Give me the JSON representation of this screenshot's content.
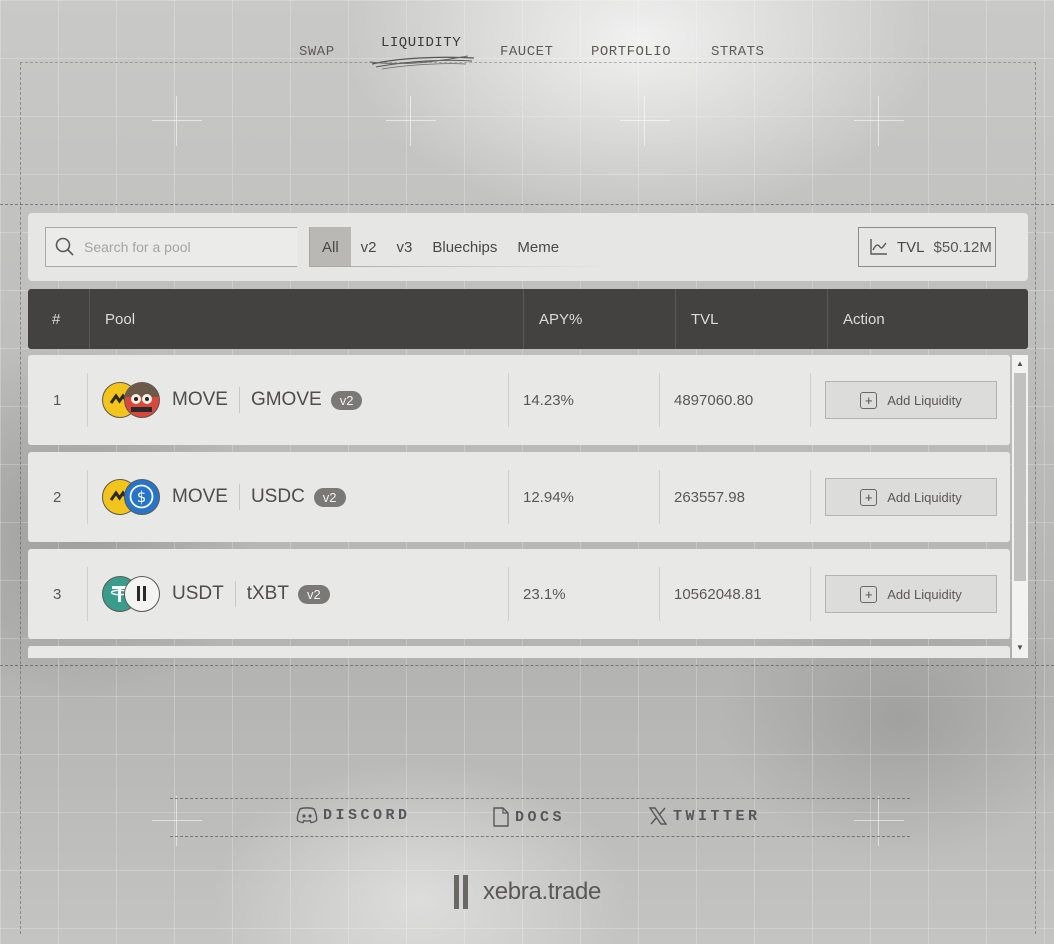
{
  "nav": {
    "items": [
      {
        "label": "SWAP",
        "active": false
      },
      {
        "label": "LIQUIDITY",
        "active": true
      },
      {
        "label": "FAUCET",
        "active": false
      },
      {
        "label": "PORTFOLIO",
        "active": false
      },
      {
        "label": "STRATS",
        "active": false
      }
    ]
  },
  "toolbar": {
    "search_placeholder": "Search for a pool",
    "filters": [
      "All",
      "v2",
      "v3",
      "Bluechips",
      "Meme"
    ],
    "active_filter": "All",
    "tvl_label": "TVL",
    "tvl_value": "$50.12M"
  },
  "table": {
    "headers": [
      "#",
      "Pool",
      "APY%",
      "TVL",
      "Action"
    ],
    "rows": [
      {
        "index": "1",
        "token_a": "MOVE",
        "token_b": "GMOVE",
        "version": "v2",
        "apy": "14.23%",
        "tvl": "4897060.80",
        "action": "Add Liquidity",
        "icon_a": "move-token-icon",
        "icon_b": "gmove-token-icon"
      },
      {
        "index": "2",
        "token_a": "MOVE",
        "token_b": "USDC",
        "version": "v2",
        "apy": "12.94%",
        "tvl": "263557.98",
        "action": "Add Liquidity",
        "icon_a": "move-token-icon",
        "icon_b": "usdc-token-icon"
      },
      {
        "index": "3",
        "token_a": "USDT",
        "token_b": "tXBT",
        "version": "v2",
        "apy": "23.1%",
        "tvl": "10562048.81",
        "action": "Add Liquidity",
        "icon_a": "usdt-token-icon",
        "icon_b": "txbt-token-icon"
      }
    ]
  },
  "footer": {
    "links": [
      {
        "label": "DISCORD",
        "icon": "discord-icon"
      },
      {
        "label": "DOCS",
        "icon": "docs-icon"
      },
      {
        "label": "TWITTER",
        "icon": "x-twitter-icon"
      }
    ],
    "brand": "xebra.trade"
  },
  "colors": {
    "header_bg": "#444240",
    "badge_bg": "#7b7975",
    "move_yellow": "#f3c51c",
    "usdc_blue": "#2775ca",
    "usdt_green": "#3a9c8c"
  }
}
